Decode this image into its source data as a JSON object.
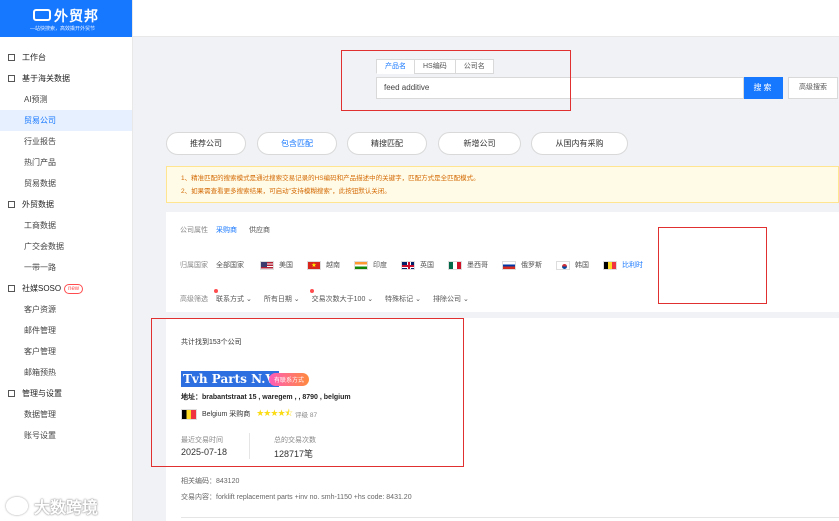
{
  "app": {
    "logo_title": "外贸邦",
    "logo_subtitle": "—站快搜索，高效撬开外贸节"
  },
  "sidebar": {
    "groups": [
      {
        "label": "工作台",
        "items": []
      },
      {
        "label": "基于海关数据",
        "items": [
          "AI预测",
          "贸易公司",
          "行业报告",
          "热门产品",
          "贸易数据"
        ]
      },
      {
        "label": "外贸数据",
        "items": [
          "工商数据",
          "广交会数据",
          "一带一路"
        ]
      },
      {
        "label": "社媒SOSO",
        "badge": "new",
        "items": [
          "客户资源",
          "邮件管理",
          "客户管理",
          "邮箱预热"
        ]
      },
      {
        "label": "管理与设置",
        "items": [
          "数据管理",
          "账号设置"
        ]
      }
    ],
    "active_item": "贸易公司"
  },
  "search": {
    "tabs": [
      "产品名",
      "HS编码",
      "公司名"
    ],
    "active_tab": "产品名",
    "value": "feed additive",
    "search_button": "搜索",
    "advanced_button": "高级搜索"
  },
  "mode_pills": [
    "推荐公司",
    "包含匹配",
    "精搜匹配",
    "新增公司",
    "从国内有采购"
  ],
  "active_pill": "包含匹配",
  "notice": {
    "line1": "1、精准匹配的搜索模式是通过搜索交易记录的HS编码和产品描述中的关键字，匹配方式是全匹配模式。",
    "line2": "2、如果需查看更多搜索结果，可启动\"支持模糊搜索\"，此按钮默认关闭。"
  },
  "filters": {
    "attr_label": "公司属性",
    "attr_options": [
      "采购商",
      "供应商"
    ],
    "attr_active": "采购商",
    "country_label": "归属国家",
    "all_countries": "全部国家",
    "countries": [
      "美国",
      "越南",
      "印度",
      "英国",
      "墨西哥",
      "俄罗斯",
      "韩国",
      "比利时"
    ],
    "active_country": "比利时",
    "adv_label": "高级筛选",
    "dropdowns": [
      "联系方式",
      "所有日期",
      "交易次数大于100",
      "特殊标记",
      "排除公司"
    ]
  },
  "results": {
    "count_text": "共计找到153个公司",
    "company": {
      "name": "Tvh Parts N.V.",
      "contact_badge": "有联系方式",
      "address": "地址：brabantstraat 15 , waregem , , 8790 , belgium",
      "country_role": "Belgium 采购商",
      "rating_text": "评级 87",
      "rating_stars": 4.5,
      "last_trade_label": "最近交易时间",
      "last_trade_value": "2025-07-18",
      "total_trades_label": "总的交易次数",
      "total_trades_value": "128717笔",
      "hs_codes": "相关编码：843120",
      "trade_content": "交易内容：forklift replacement parts +inv no. smh-1150 +hs code: 8431.20"
    }
  },
  "watermark": "大数跨境",
  "colors": {
    "accent": "#1677ff",
    "highlight_box": "#e03030",
    "notice_text": "#d46b08"
  }
}
